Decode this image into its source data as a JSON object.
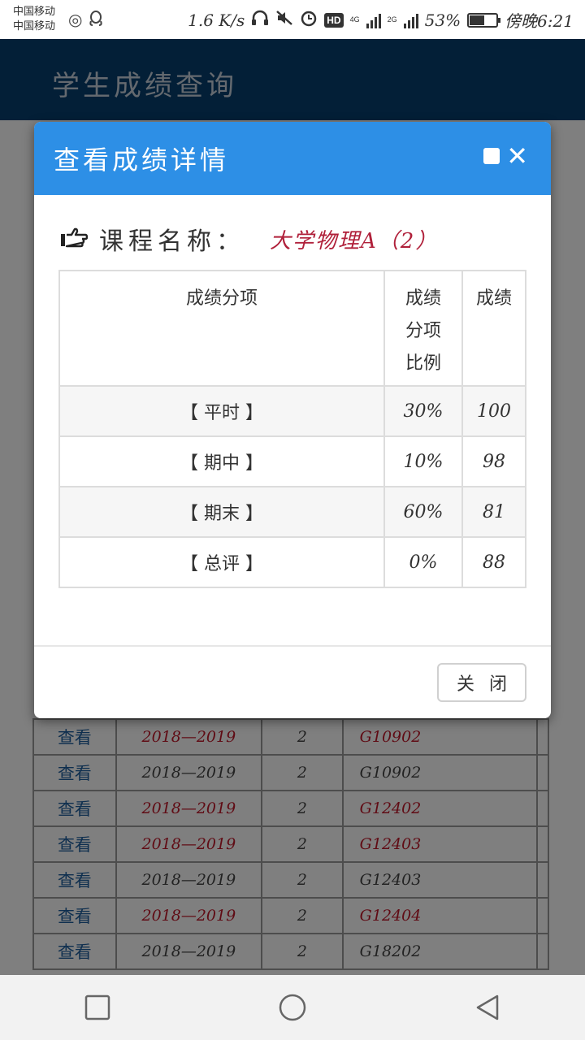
{
  "status_bar": {
    "carrier_1": "中国移动",
    "carrier_2": "中国移动",
    "speed": "1.6 K/s",
    "hd": "HD",
    "net_a": "4G",
    "net_b": "2G",
    "battery_pct": "53%",
    "battery_level": 0.53,
    "time": "傍晚6:21"
  },
  "app": {
    "title": "学生成绩查询"
  },
  "modal": {
    "title": "查看成绩详情",
    "course_label": "课程名称：",
    "course_name": "大学物理A（2）",
    "headers": {
      "item": "成绩分项",
      "ratio": "成绩分项比例",
      "score": "成绩"
    },
    "rows": [
      {
        "item": "【  平时  】",
        "ratio": "30%",
        "score": "100"
      },
      {
        "item": "【  期中  】",
        "ratio": "10%",
        "score": "98"
      },
      {
        "item": "【  期末  】",
        "ratio": "60%",
        "score": "81"
      },
      {
        "item": "【  总评  】",
        "ratio": "0%",
        "score": "88"
      }
    ],
    "close_label": "关闭"
  },
  "background_table": {
    "rows": [
      {
        "action": "查看",
        "year": "2018—2019",
        "term": "2",
        "code": "G10902"
      },
      {
        "action": "查看",
        "year": "2018—2019",
        "term": "2",
        "code": "G10902"
      },
      {
        "action": "查看",
        "year": "2018—2019",
        "term": "2",
        "code": "G12402"
      },
      {
        "action": "查看",
        "year": "2018—2019",
        "term": "2",
        "code": "G12403"
      },
      {
        "action": "查看",
        "year": "2018—2019",
        "term": "2",
        "code": "G12403"
      },
      {
        "action": "查看",
        "year": "2018—2019",
        "term": "2",
        "code": "G12404"
      },
      {
        "action": "查看",
        "year": "2018—2019",
        "term": "2",
        "code": "G18202"
      }
    ]
  },
  "icons": {
    "hand": "pointing-hand-icon",
    "close": "close-icon",
    "maximize": "maximize-icon",
    "nav_recent": "square-icon",
    "nav_home": "circle-icon",
    "nav_back": "triangle-back-icon"
  },
  "colors": {
    "header_bar": "#063e6e",
    "modal_header": "#2d8fe6",
    "course_name": "#b0203a",
    "link_blue": "#1f5f9e",
    "red_text": "#c0182a"
  }
}
